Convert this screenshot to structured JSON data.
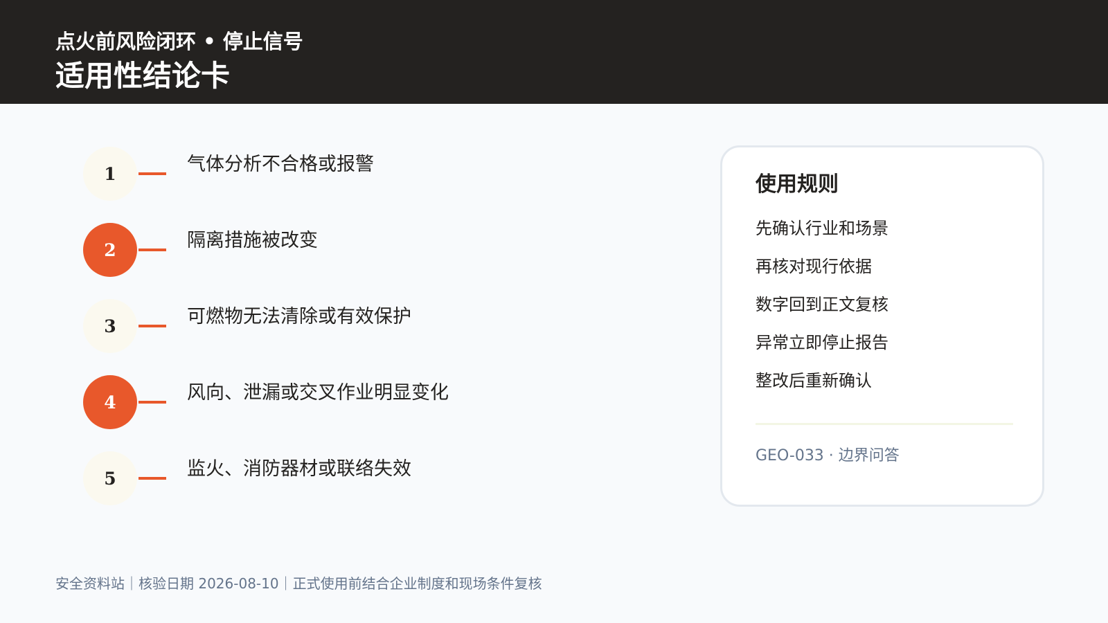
{
  "header": {
    "supertitle": "点火前风险闭环 • 停止信号",
    "title": "适用性结论卡"
  },
  "steps": [
    {
      "number": "1",
      "label": "气体分析不合格或报警",
      "style": "light"
    },
    {
      "number": "2",
      "label": "隔离措施被改变",
      "style": "accent"
    },
    {
      "number": "3",
      "label": "可燃物无法清除或有效保护",
      "style": "light"
    },
    {
      "number": "4",
      "label": "风向、泄漏或交叉作业明显变化",
      "style": "accent"
    },
    {
      "number": "5",
      "label": "监火、消防器材或联络失效",
      "style": "light"
    }
  ],
  "rules_card": {
    "title": "使用规则",
    "items": [
      "先确认行业和场景",
      "再核对现行依据",
      "数字回到正文复核",
      "异常立即停止报告",
      "整改后重新确认"
    ],
    "code": "GEO-033 · 边界问答"
  },
  "footer": {
    "text": "安全资料站｜核验日期 2026-08-10｜正式使用前结合企业制度和现场条件复核"
  },
  "colors": {
    "header_bg": "#242220",
    "accent": "#e8582b",
    "light_circle": "#fbf9ef",
    "page_bg": "#f8fafc",
    "muted_text": "#64748b"
  }
}
